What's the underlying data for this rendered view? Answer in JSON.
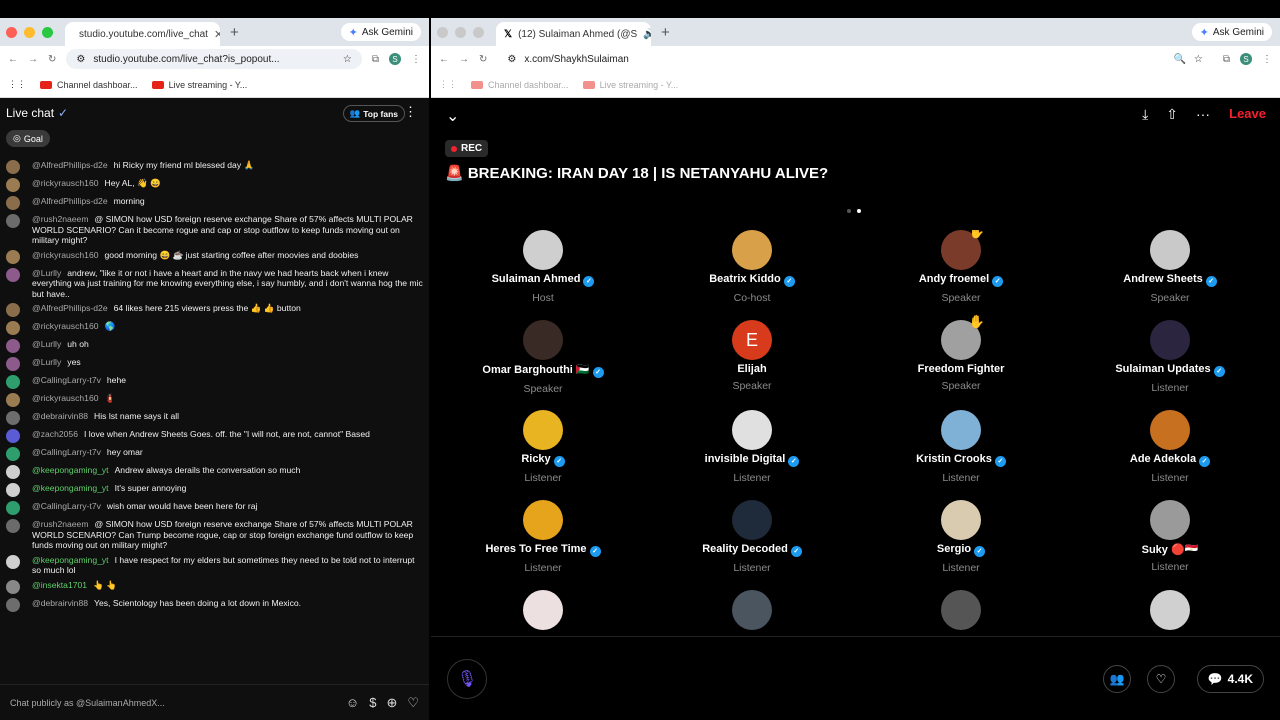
{
  "left_window": {
    "tab_title": "studio.youtube.com/live_chat",
    "url": "studio.youtube.com/live_chat?is_popout...",
    "gemini": "Ask Gemini",
    "bookmarks": [
      "Channel dashboar...",
      "Live streaming - Y..."
    ],
    "chat_title": "Live chat",
    "top_fans": "Top fans",
    "goal": "Goal",
    "messages": [
      {
        "author": "@AlfredPhillips-d2e",
        "text": "hi Ricky my friend ml blessed day 🙏",
        "color": "#8a6d4a",
        "mod": false
      },
      {
        "author": "@rickyrausch160",
        "text": "Hey AL, 👋 😀",
        "color": "#9a7b52",
        "mod": false
      },
      {
        "author": "@AlfredPhillips-d2e",
        "text": "morning",
        "color": "#8a6d4a",
        "mod": false
      },
      {
        "author": "@rush2naeem",
        "text": "@ SIMON how USD foreign reserve exchange Share of 57% affects MULTI POLAR WORLD SCENARIO? Can it become rogue and cap or stop outflow to keep funds moving out on military might?",
        "color": "#6b6b6b",
        "mod": false
      },
      {
        "author": "@rickyrausch160",
        "text": "good morning 😄 ☕ just starting coffee after moovies and doobies",
        "color": "#9a7b52",
        "mod": false
      },
      {
        "author": "@Lurlly",
        "text": "andrew, \"like it or not i have a heart and in the navy we had hearts back when i knew everything wa just training for me knowing everything else, i say humbly, and i don't wanna hog the mic but have..",
        "color": "#8c5b8c",
        "mod": false
      },
      {
        "author": "@AlfredPhillips-d2e",
        "text": "64 likes here 215 viewers press the 👍 👍 button",
        "color": "#8a6d4a",
        "mod": false
      },
      {
        "author": "@rickyrausch160",
        "text": "🌎",
        "color": "#9a7b52",
        "mod": false
      },
      {
        "author": "@Lurlly",
        "text": "uh oh",
        "color": "#8c5b8c",
        "mod": false
      },
      {
        "author": "@Lurlly",
        "text": "yes",
        "color": "#8c5b8c",
        "mod": false
      },
      {
        "author": "@CallingLarry-t7v",
        "text": "hehe",
        "color": "#2e9e6e",
        "mod": false
      },
      {
        "author": "@rickyrausch160",
        "text": "🧯",
        "color": "#9a7b52",
        "mod": false
      },
      {
        "author": "@debrairvin88",
        "text": "His lst name says it all",
        "color": "#6d6d6d",
        "mod": false
      },
      {
        "author": "@zach2056",
        "text": "I love when Andrew Sheets Goes. off. the \"I will not, are not, cannot\" Based",
        "color": "#5b5bd6",
        "mod": false
      },
      {
        "author": "@CallingLarry-t7v",
        "text": "hey omar",
        "color": "#2e9e6e",
        "mod": false
      },
      {
        "author": "@keepongaming_yt",
        "text": "Andrew always derails the conversation so much",
        "color": "#cfcfcf",
        "mod": true
      },
      {
        "author": "@keepongaming_yt",
        "text": "It's super annoying",
        "color": "#cfcfcf",
        "mod": true
      },
      {
        "author": "@CallingLarry-t7v",
        "text": "wish omar would have been here for raj",
        "color": "#2e9e6e",
        "mod": false
      },
      {
        "author": "@rush2naeem",
        "text": "@ SIMON how USD foreign reserve exchange Share of 57% affects MULTI POLAR WORLD SCENARIO? Can Trump become rogue, cap or stop foreign exchange fund outflow to keep funds moving out on military might?",
        "color": "#6b6b6b",
        "mod": false
      },
      {
        "author": "@keepongaming_yt",
        "text": "I have respect for my elders but sometimes they need to be told not to interrupt so much lol",
        "color": "#cfcfcf",
        "mod": true
      },
      {
        "author": "@insekta1701",
        "text": "👆 👆",
        "color": "#888",
        "mod": true
      },
      {
        "author": "@debrairvin88",
        "text": "Yes, Scientology has been doing a lot down in Mexico.",
        "color": "#6d6d6d",
        "mod": false
      }
    ],
    "input_placeholder": "Chat publicly as @SulaimanAhmedX..."
  },
  "right_window": {
    "tab_title": "(12) Sulaiman Ahmed (@S",
    "url": "x.com/ShaykhSulaiman",
    "gemini": "Ask Gemini",
    "bookmarks": [
      "Channel dashboar...",
      "Live streaming - Y..."
    ],
    "leave": "Leave",
    "rec": "REC",
    "space_title": "🚨 BREAKING: IRAN DAY 18 | IS NETANYAHU ALIVE?",
    "participants": [
      {
        "name": "Sulaiman Ahmed",
        "role": "Host",
        "verified": true,
        "hand": false,
        "color": "#cfcfcf",
        "letter": ""
      },
      {
        "name": "Beatrix Kiddo",
        "role": "Co-host",
        "verified": true,
        "hand": false,
        "color": "#d9a04a",
        "letter": ""
      },
      {
        "name": "Andy froemel",
        "role": "Speaker",
        "verified": true,
        "hand": true,
        "color": "#7a3b2a",
        "letter": ""
      },
      {
        "name": "Andrew Sheets",
        "role": "Speaker",
        "verified": true,
        "hand": false,
        "color": "#c9c9c9",
        "letter": ""
      },
      {
        "name": "Omar Barghouthi 🇵🇸",
        "role": "Speaker",
        "verified": true,
        "hand": false,
        "color": "#3a2a25",
        "letter": ""
      },
      {
        "name": "Elijah",
        "role": "Speaker",
        "verified": false,
        "hand": false,
        "color": "#d83b1c",
        "letter": "E"
      },
      {
        "name": "Freedom Fighter",
        "role": "Speaker",
        "verified": false,
        "hand": true,
        "color": "#a0a0a0",
        "letter": ""
      },
      {
        "name": "Sulaiman Updates",
        "role": "Listener",
        "verified": true,
        "hand": false,
        "color": "#2b2540",
        "letter": ""
      },
      {
        "name": "Ricky",
        "role": "Listener",
        "verified": true,
        "hand": false,
        "color": "#e8b422",
        "letter": ""
      },
      {
        "name": "invisible Digital",
        "role": "Listener",
        "verified": true,
        "hand": false,
        "color": "#e0e0e0",
        "letter": ""
      },
      {
        "name": "Kristin Crooks",
        "role": "Listener",
        "verified": true,
        "hand": false,
        "color": "#7fb0d6",
        "letter": ""
      },
      {
        "name": "Ade Adekola",
        "role": "Listener",
        "verified": true,
        "hand": false,
        "color": "#c7701f",
        "letter": ""
      },
      {
        "name": "Heres To Free Time",
        "role": "Listener",
        "verified": true,
        "hand": false,
        "color": "#e5a41c",
        "letter": ""
      },
      {
        "name": "Reality Decoded",
        "role": "Listener",
        "verified": true,
        "hand": false,
        "color": "#1f2a3a",
        "letter": ""
      },
      {
        "name": "Sergio",
        "role": "Listener",
        "verified": true,
        "hand": false,
        "color": "#d8cbb0",
        "letter": ""
      },
      {
        "name": "Suky 🔴🇪🇬",
        "role": "Listener",
        "verified": false,
        "hand": false,
        "color": "#9a9a9a",
        "letter": ""
      },
      {
        "name": "",
        "role": "",
        "verified": false,
        "hand": false,
        "color": "#ece0e0",
        "letter": ""
      },
      {
        "name": "",
        "role": "",
        "verified": false,
        "hand": false,
        "color": "#4a5560",
        "letter": ""
      },
      {
        "name": "",
        "role": "",
        "verified": false,
        "hand": false,
        "color": "#555",
        "letter": ""
      },
      {
        "name": "",
        "role": "",
        "verified": false,
        "hand": false,
        "color": "#d0d0d0",
        "letter": ""
      }
    ],
    "listener_count": "4.4K"
  }
}
